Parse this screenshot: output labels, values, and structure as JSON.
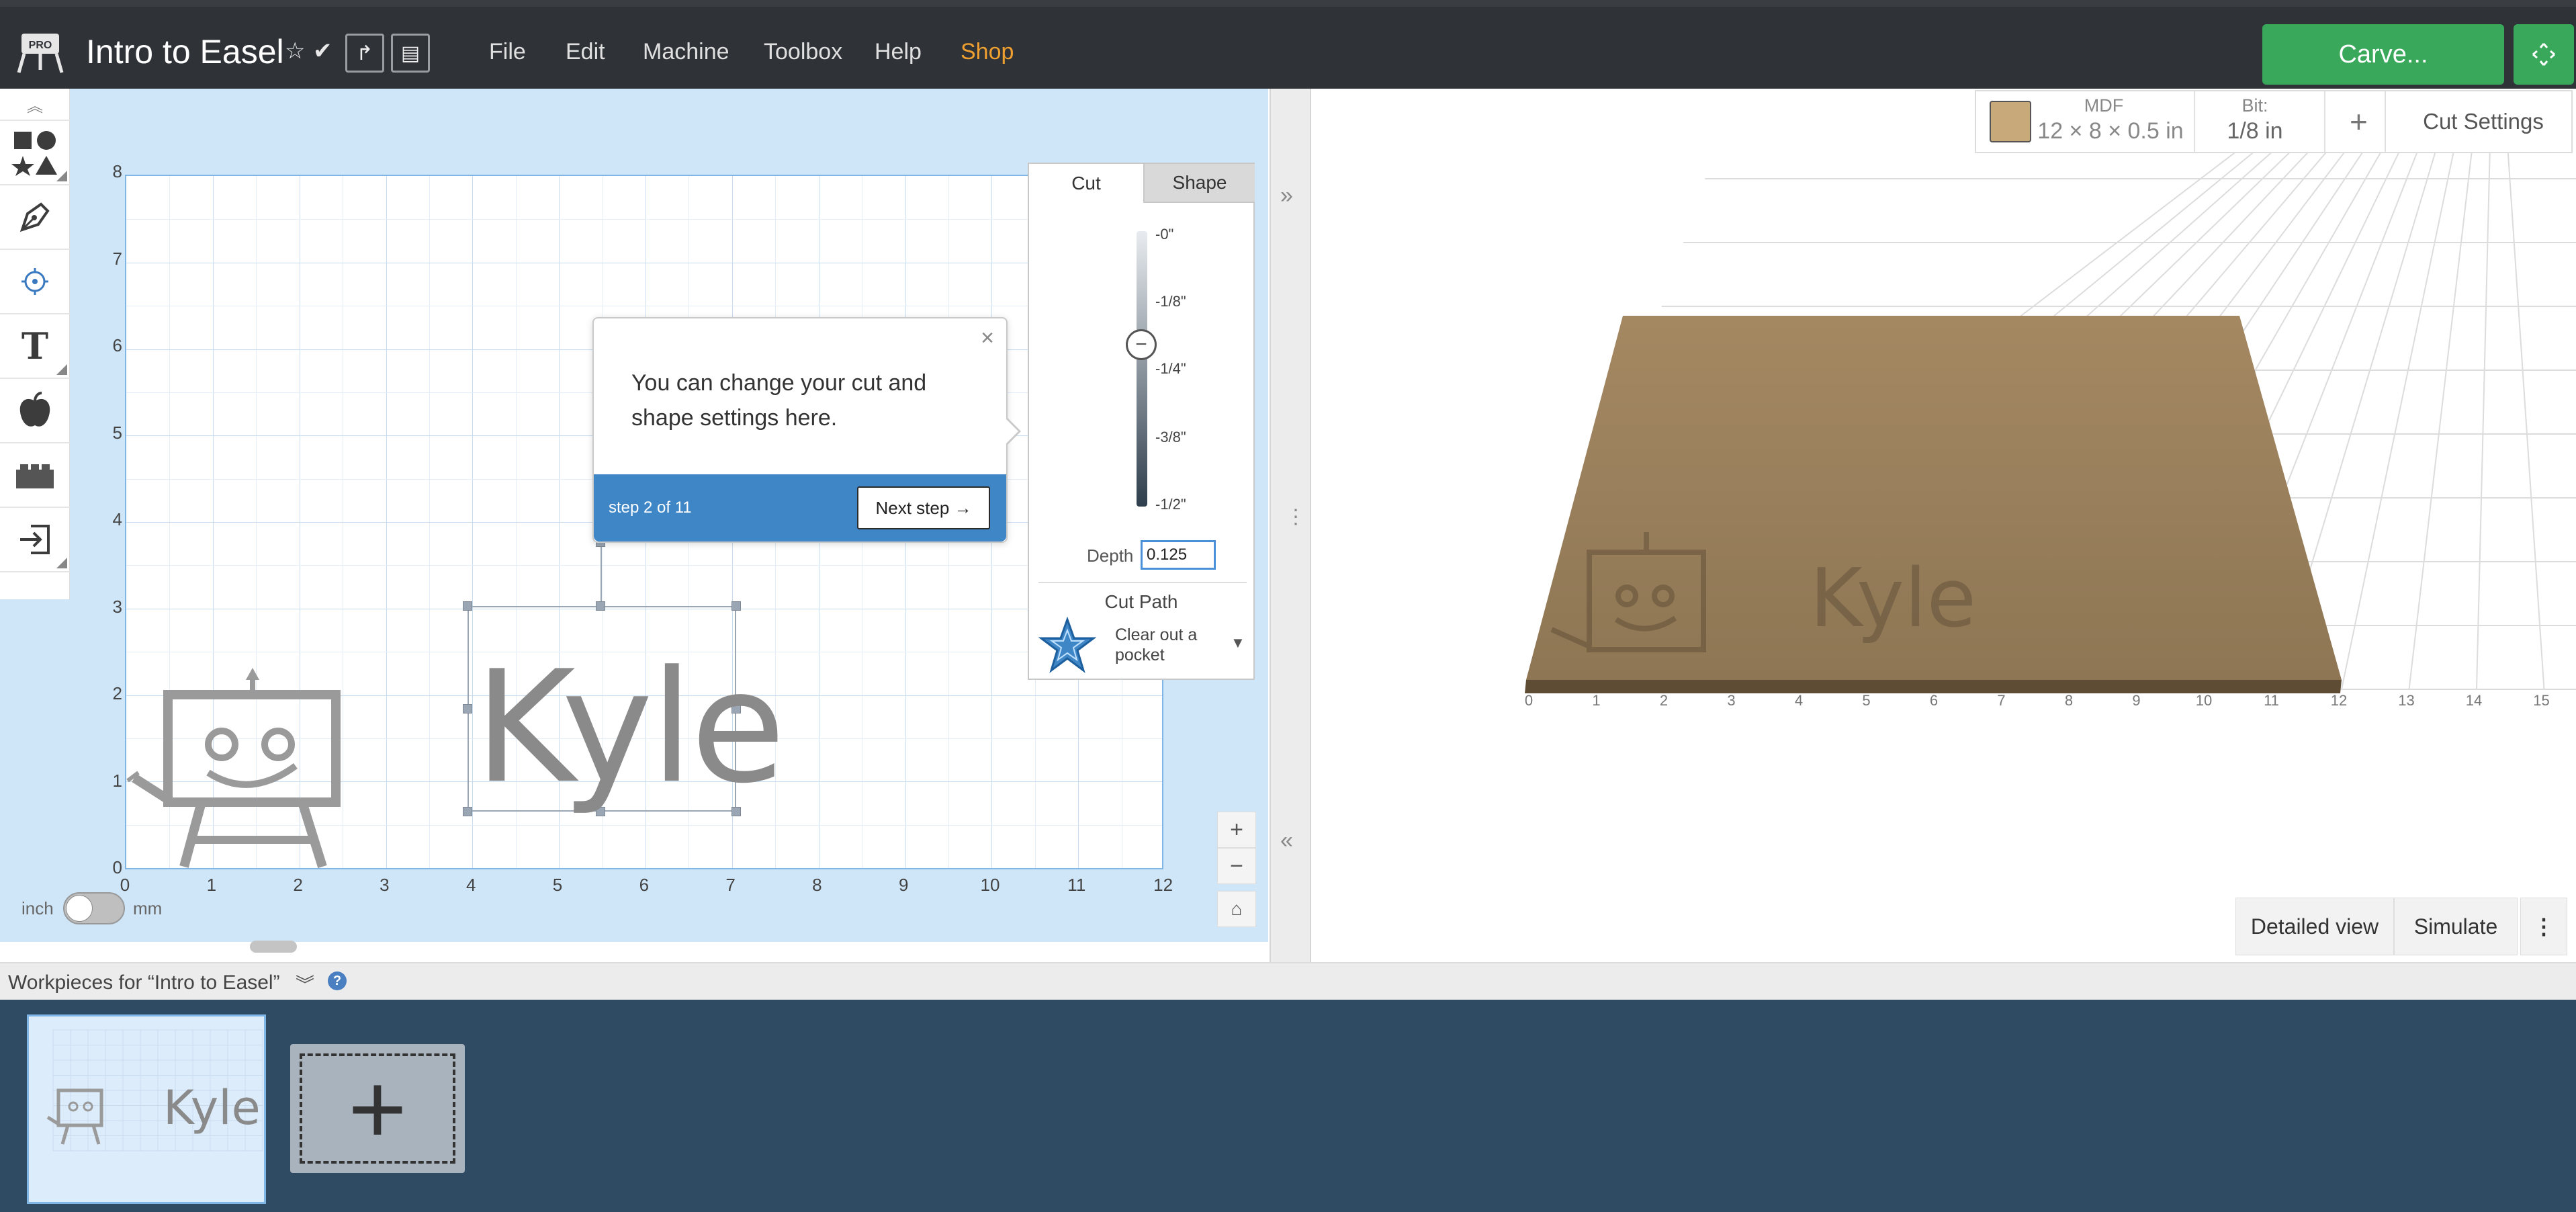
{
  "app": {
    "title": "Intro to Easel",
    "menu": [
      "File",
      "Edit",
      "Machine",
      "Toolbox",
      "Help",
      "Shop"
    ],
    "carve_label": "Carve...",
    "accent_color": "#3aa85a",
    "shop_color": "#f0a030"
  },
  "tools": [
    "shapes-icon",
    "pen-icon",
    "point-icon",
    "text-icon",
    "apple-icon",
    "lego-icon",
    "import-icon"
  ],
  "canvas": {
    "x_ticks": [
      "0",
      "1",
      "2",
      "3",
      "4",
      "5",
      "6",
      "7",
      "8",
      "9",
      "10",
      "11",
      "12"
    ],
    "y_ticks": [
      "0",
      "1",
      "2",
      "3",
      "4",
      "5",
      "6",
      "7",
      "8"
    ],
    "text_object": "Kyle"
  },
  "tooltip": {
    "body": "You can change your cut and shape settings here.",
    "step": "step 2 of 11",
    "next": "Next step →"
  },
  "cut_panel": {
    "tab_cut": "Cut",
    "tab_shape": "Shape",
    "depth_labels": [
      "-0\"",
      "-1/8\"",
      "-1/4\"",
      "-3/8\"",
      "-1/2\""
    ],
    "depth_caption": "Depth",
    "depth_value": "0.125",
    "cut_path_title": "Cut Path",
    "cut_path_value": "Clear out a pocket"
  },
  "units": {
    "inch": "inch",
    "mm": "mm"
  },
  "material": {
    "name": "MDF",
    "dims": "12 × 8 × 0.5 in",
    "bit_label": "Bit:",
    "bit_value": "1/8 in",
    "plus": "+",
    "cut_settings": "Cut Settings",
    "swatch_color": "#c8a97a"
  },
  "preview": {
    "x_ticks": [
      "0",
      "1",
      "2",
      "3",
      "4",
      "5",
      "6",
      "7",
      "8",
      "9",
      "10",
      "11",
      "12",
      "13",
      "14",
      "15"
    ],
    "engraved_text": "Kyle"
  },
  "view_buttons": {
    "detailed": "Detailed view",
    "simulate": "Simulate",
    "more": "⋮"
  },
  "workpieces": {
    "title": "Workpieces for “Intro to Easel”",
    "help": "?",
    "thumb_text": "Kyle",
    "add": "+"
  }
}
